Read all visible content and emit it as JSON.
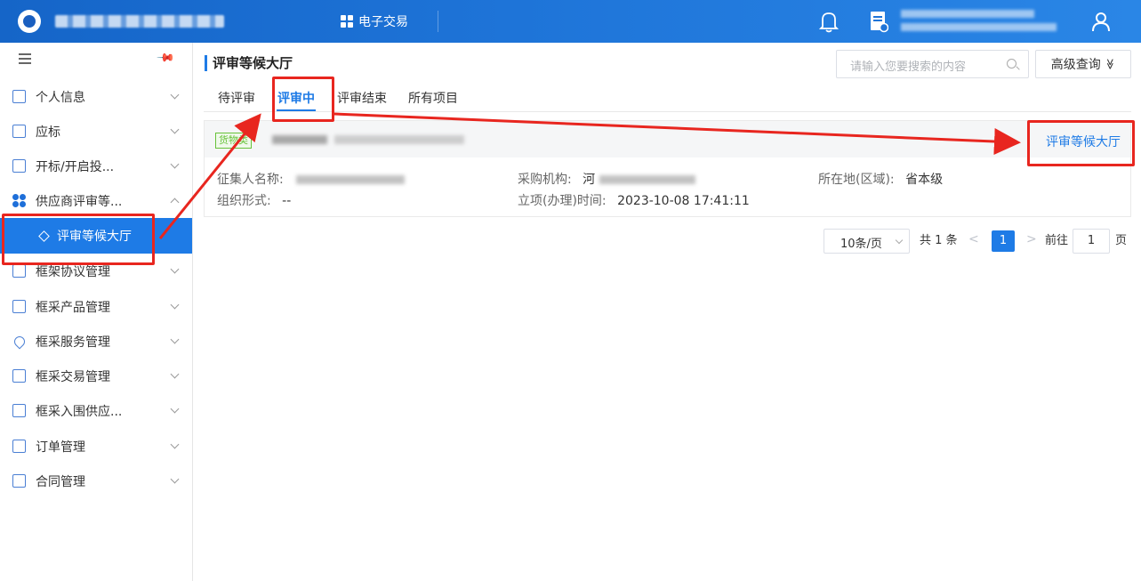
{
  "topbar": {
    "nav_label": "电子交易"
  },
  "sidebar": {
    "items": [
      {
        "label": "个人信息"
      },
      {
        "label": "应标"
      },
      {
        "label": "开标/开启投..."
      },
      {
        "label": "供应商评审等..."
      },
      {
        "label": "框架协议管理"
      },
      {
        "label": "框采产品管理"
      },
      {
        "label": "框采服务管理"
      },
      {
        "label": "框采交易管理"
      },
      {
        "label": "框采入围供应..."
      },
      {
        "label": "订单管理"
      },
      {
        "label": "合同管理"
      }
    ],
    "active_sub": "评审等候大厅"
  },
  "main": {
    "title": "评审等候大厅",
    "search_placeholder": "请输入您要搜索的内容",
    "advanced_label": "高级查询",
    "advanced_icon": "≫",
    "tabs": [
      {
        "label": "待评审"
      },
      {
        "label": "评审中"
      },
      {
        "label": "评审结束"
      },
      {
        "label": "所有项目"
      }
    ],
    "card": {
      "tag": "货物类",
      "action_link": "评审等候大厅",
      "fields": {
        "collector_key": "征集人名称:",
        "org_form_key": "组织形式:",
        "org_form_value": "--",
        "purchaser_key": "采购机构:",
        "purchaser_prefix": "河",
        "setup_time_key": "立项(办理)时间:",
        "setup_time_value": "2023-10-08 17:41:11",
        "location_key": "所在地(区域):",
        "location_value": "省本级"
      }
    },
    "pagination": {
      "page_size": "10条/页",
      "total": "共 1 条",
      "current_page": "1",
      "goto_label": "前往",
      "goto_value": "1",
      "page_suffix": "页"
    }
  },
  "colors": {
    "primary": "#1e7be6",
    "annotation_red": "#e8261f",
    "tag_green": "#67c23a"
  }
}
